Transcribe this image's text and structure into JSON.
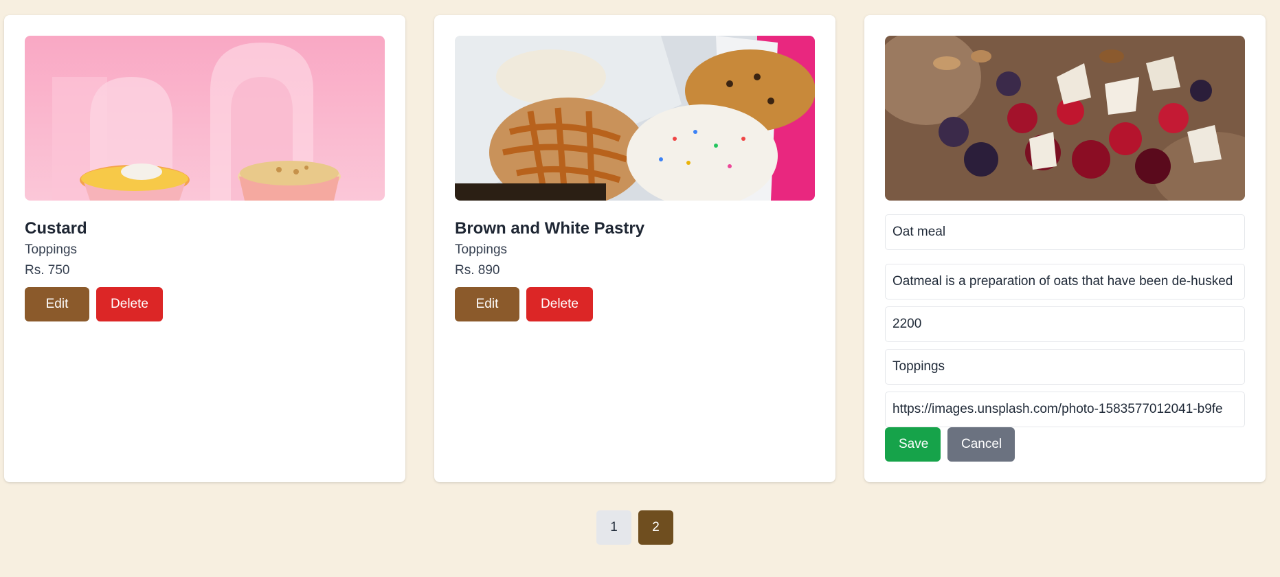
{
  "products": [
    {
      "title": "Custard",
      "category": "Toppings",
      "price": "Rs. 750",
      "edit_label": "Edit",
      "delete_label": "Delete"
    },
    {
      "title": "Brown and White Pastry",
      "category": "Toppings",
      "price": "Rs. 890",
      "edit_label": "Edit",
      "delete_label": "Delete"
    }
  ],
  "edit_form": {
    "name_value": "Oat meal",
    "description_value": "Oatmeal is a preparation of oats that have been de-husked",
    "price_value": "2200",
    "category_value": "Toppings",
    "image_url_value": "https://images.unsplash.com/photo-1583577012041-b9fe",
    "save_label": "Save",
    "cancel_label": "Cancel"
  },
  "pagination": {
    "pages": [
      "1",
      "2"
    ],
    "active_page": "2"
  },
  "colors": {
    "background": "#f7efe0",
    "edit_button": "#8b5a2b",
    "delete_button": "#dc2626",
    "save_button": "#16a34a",
    "cancel_button": "#6b7280",
    "active_page": "#6f4e1f"
  }
}
